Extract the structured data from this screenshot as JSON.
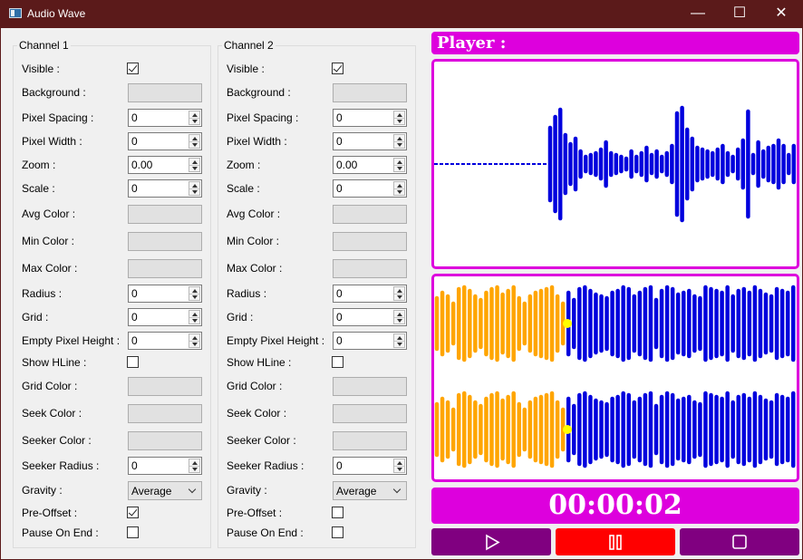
{
  "window": {
    "title": "Audio Wave",
    "icon": "app-window-icon",
    "minimize": "—",
    "maximize": "☐",
    "close": "✕"
  },
  "channels": [
    {
      "title": "Channel 1",
      "labels": {
        "visible": "Visible :",
        "background": "Background :",
        "pixel_spacing": "Pixel Spacing :",
        "pixel_width": "Pixel Width :",
        "zoom": "Zoom :",
        "scale": "Scale :",
        "avg_color": "Avg Color :",
        "min_color": "Min Color :",
        "max_color": "Max Color :",
        "radius": "Radius :",
        "grid": "Grid :",
        "empty_pixel_height": "Empty Pixel Height :",
        "show_hline": "Show HLine :",
        "grid_color": "Grid Color :",
        "seek_color": "Seek Color :",
        "seeker_color": "Seeker Color :",
        "seeker_radius": "Seeker Radius :",
        "gravity": "Gravity :",
        "pre_offset": "Pre-Offset :",
        "pause_on_end": "Pause On End :"
      },
      "values": {
        "visible": true,
        "pixel_spacing": "0",
        "pixel_width": "0",
        "zoom": "0.00",
        "scale": "0",
        "radius": "0",
        "grid": "0",
        "empty_pixel_height": "0",
        "show_hline": false,
        "seeker_radius": "0",
        "gravity": "Average",
        "pre_offset": true,
        "pause_on_end": false
      }
    },
    {
      "title": "Channel 2",
      "labels": {
        "visible": "Visible :",
        "background": "Background :",
        "pixel_spacing": "Pixel Spacing :",
        "pixel_width": "Pixel Width :",
        "zoom": "Zoom :",
        "scale": "Scale :",
        "avg_color": "Avg Color :",
        "min_color": "Min Color :",
        "max_color": "Max Color :",
        "radius": "Radius :",
        "grid": "Grid :",
        "empty_pixel_height": "Empty Pixel Height :",
        "show_hline": "Show HLine :",
        "grid_color": "Grid Color :",
        "seek_color": "Seek Color :",
        "seeker_color": "Seeker Color :",
        "seeker_radius": "Seeker Radius :",
        "gravity": "Gravity :",
        "pre_offset": "Pre-Offset :",
        "pause_on_end": "Pause On End :"
      },
      "values": {
        "visible": true,
        "pixel_spacing": "0",
        "pixel_width": "0",
        "zoom": "0.00",
        "scale": "0",
        "radius": "0",
        "grid": "0",
        "empty_pixel_height": "0",
        "show_hline": false,
        "seeker_radius": "0",
        "gravity": "Average",
        "pre_offset": false,
        "pause_on_end": false
      }
    }
  ],
  "player": {
    "title": "Player :",
    "time": "00:00:02",
    "progress": 0.36,
    "buttons": [
      {
        "name": "play-button",
        "icon": "play-icon",
        "color": "#800080"
      },
      {
        "name": "pause-button",
        "icon": "pause-icon",
        "color": "#ff0000"
      },
      {
        "name": "stop-button",
        "icon": "stop-icon",
        "color": "#800080"
      }
    ]
  },
  "colors": {
    "accent": "#dd00dd",
    "wave": "#0000dd",
    "played": "#ffa500",
    "seeker": "#ffff00",
    "titlebar": "#5b1a1a",
    "swatch": "#e1e1e1"
  }
}
